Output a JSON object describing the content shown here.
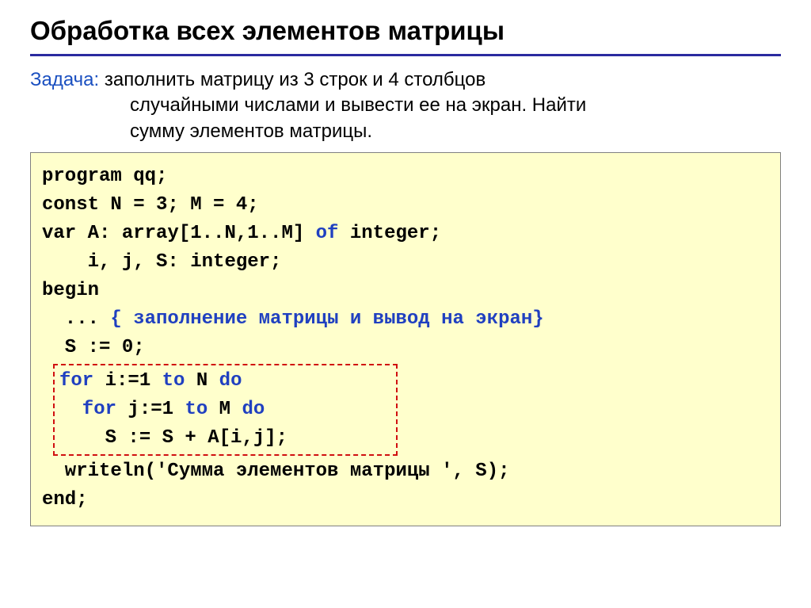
{
  "title": "Обработка всех элементов матрицы",
  "task": {
    "label": "Задача:",
    "line1_rest": " заполнить матрицу из 3 строк и 4 столбцов",
    "line2": "случайными числами и вывести ее на экран. Найти",
    "line3": "сумму элементов матрицы."
  },
  "code": {
    "l1": "program qq;",
    "l2": "const N = 3; M = 4;",
    "l3a": "var A: array[1..N,1..M] ",
    "l3b": "of",
    "l3c": " integer;",
    "l4": "    i, j, S: integer;",
    "l5": "begin",
    "l6a": "  ... ",
    "l6b": "{ заполнение матрицы и вывод на экран}",
    "l7": "  S := 0;",
    "loop1a": "for",
    "loop1b": " i:=1 ",
    "loop1c": "to",
    "loop1d": " N ",
    "loop1e": "do",
    "loop2a": "  for",
    "loop2b": " j:=1 ",
    "loop2c": "to",
    "loop2d": " M ",
    "loop2e": "do",
    "loop3": "    S := S + A[i,j];",
    "l11": "  writeln('Сумма элементов матрицы ', S);",
    "l12": "end;"
  }
}
